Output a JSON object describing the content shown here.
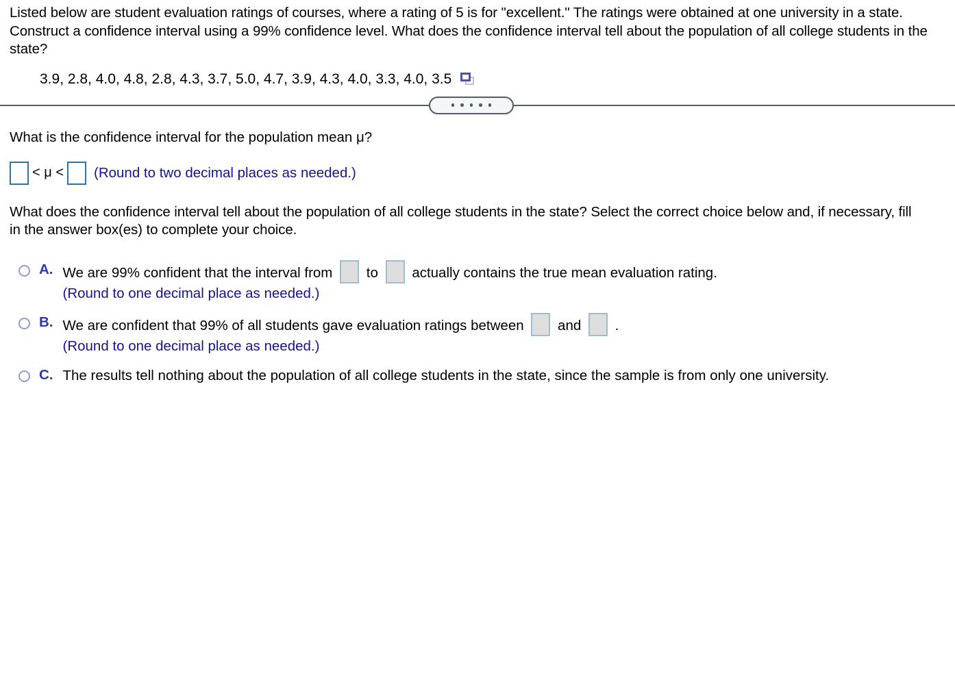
{
  "problem": {
    "statement": "Listed below are student evaluation ratings of courses, where a rating of 5 is for \"excellent.\" The ratings were obtained at one university in a state. Construct a confidence interval using a 99% confidence level. What does the confidence interval tell about the population of all college students in the state?",
    "data_values": "3.9, 2.8, 4.0, 4.8, 2.8, 4.3, 3.7, 5.0, 4.7, 3.9, 4.3, 4.0, 3.3, 4.0, 3.5",
    "copy_icon": "copy-icon"
  },
  "divider": {
    "dots_count": 5,
    "expand_icon": "ellipsis-expand-icon"
  },
  "question1": {
    "text": "What is the confidence interval for the population mean μ?",
    "lower_bound_value": "",
    "lower_bound_placeholder": "",
    "upper_bound_value": "",
    "upper_bound_placeholder": "",
    "inequality_symbol": "< μ <",
    "round_note": "(Round to two decimal places as needed.)"
  },
  "question2": {
    "text": "What does the confidence interval tell about the population of all college students in the state? Select the correct choice below and, if necessary, fill in the answer box(es) to complete your choice."
  },
  "choices": [
    {
      "letter": "A.",
      "selected": false,
      "text_before": "We are 99% confident that the interval from",
      "text_middle": "to",
      "text_after": "actually contains the true mean evaluation rating.",
      "box1_value": "",
      "box2_value": "",
      "note": "(Round to one decimal place as needed.)",
      "has_boxes": true
    },
    {
      "letter": "B.",
      "selected": false,
      "text_before": "We are confident that 99% of all students gave evaluation ratings between",
      "text_middle": "and",
      "text_after": ".",
      "box1_value": "",
      "box2_value": "",
      "note": "(Round to one decimal place as needed.)",
      "has_boxes": true
    },
    {
      "letter": "C.",
      "selected": false,
      "text_before": "The results tell nothing about the population of all college students in the state, since the sample is from only one university.",
      "text_middle": "",
      "text_after": "",
      "box1_value": "",
      "box2_value": "",
      "note": "",
      "has_boxes": false
    }
  ],
  "colors": {
    "note_blue": "#14148c",
    "letter_blue": "#2b3ba8",
    "input_border": "#37709a",
    "filled_box_bg": "#dedede",
    "filled_box_border": "#9dbed0",
    "radio_border": "#8f9ed6",
    "divider": "#515d69"
  }
}
